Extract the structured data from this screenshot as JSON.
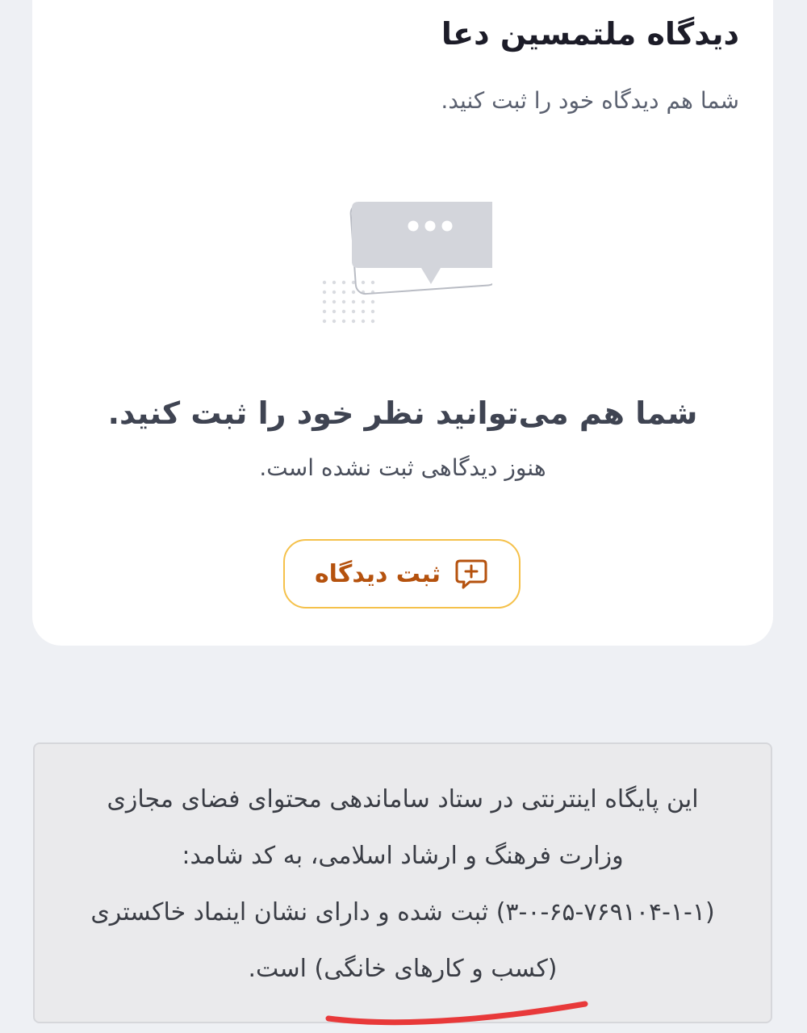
{
  "comments": {
    "title": "دیدگاه ملتمسین دعا",
    "subtitle": "شما هم دیدگاه خود را ثبت کنید.",
    "empty_title": "شما هم می‌توانید نظر خود را ثبت کنید.",
    "empty_subtitle": "هنوز دیدگاهی ثبت نشده است.",
    "submit_button": {
      "label": "ثبت دیدگاه",
      "icon": "comment-add-icon"
    }
  },
  "footer": {
    "notice": "این پایگاه اینترنتی در ستاد ساماندهی محتوای فضای مجازی وزارت فرهنگ و ارشاد اسلامی، به کد شامد: (۱-۱-۷۶۹۱۰۴-۶۵-۰-۳) ثبت شده و دارای نشان اینماد خاکستری (کسب و کارهای خانگی) است."
  },
  "colors": {
    "page_background": "#eef0f4",
    "card_background": "#ffffff",
    "button_border": "#f5c14b",
    "button_text": "#b5520e",
    "annotation_underline": "#e8393a"
  }
}
